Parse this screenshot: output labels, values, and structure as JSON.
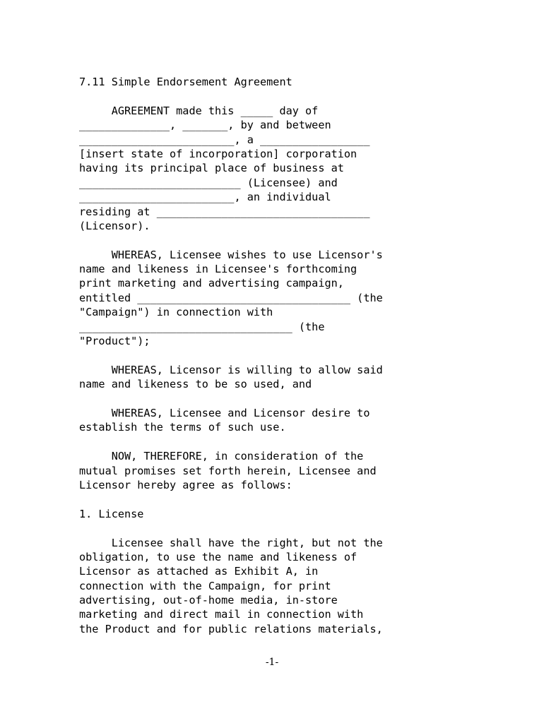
{
  "document": {
    "title": "7.11 Simple Endorsement Agreement",
    "page_number": "-1-",
    "background_color": "#ffffff",
    "text_color": "#000000",
    "lines": [
      "7.11 Simple Endorsement Agreement",
      "",
      "     AGREEMENT made this _____ day of",
      "______________, _______, by and between",
      "________________________, a _________________",
      "[insert state of incorporation] corporation",
      "having its principal place of business at",
      "_________________________ (Licensee) and",
      "________________________, an individual",
      "residing at _________________________________",
      "(Licensor).",
      "",
      "     WHEREAS, Licensee wishes to use Licensor's",
      "name and likeness in Licensee's forthcoming",
      "print marketing and advertising campaign,",
      "entitled _________________________________ (the",
      "\"Campaign\") in connection with",
      "_________________________________ (the",
      "\"Product\");",
      "",
      "     WHEREAS, Licensor is willing to allow said",
      "name and likeness to be so used, and",
      "",
      "     WHEREAS, Licensee and Licensor desire to",
      "establish the terms of such use.",
      "",
      "     NOW, THEREFORE, in consideration of the",
      "mutual promises set forth herein, Licensee and",
      "Licensor hereby agree as follows:",
      "",
      "1. License",
      "",
      "     Licensee shall have the right, but not the",
      "obligation, to use the name and likeness of",
      "Licensor as attached as Exhibit A, in",
      "connection with the Campaign, for print",
      "advertising, out-of-home media, in-store",
      "marketing and direct mail in connection with",
      "the Product and for public relations materials,"
    ]
  }
}
